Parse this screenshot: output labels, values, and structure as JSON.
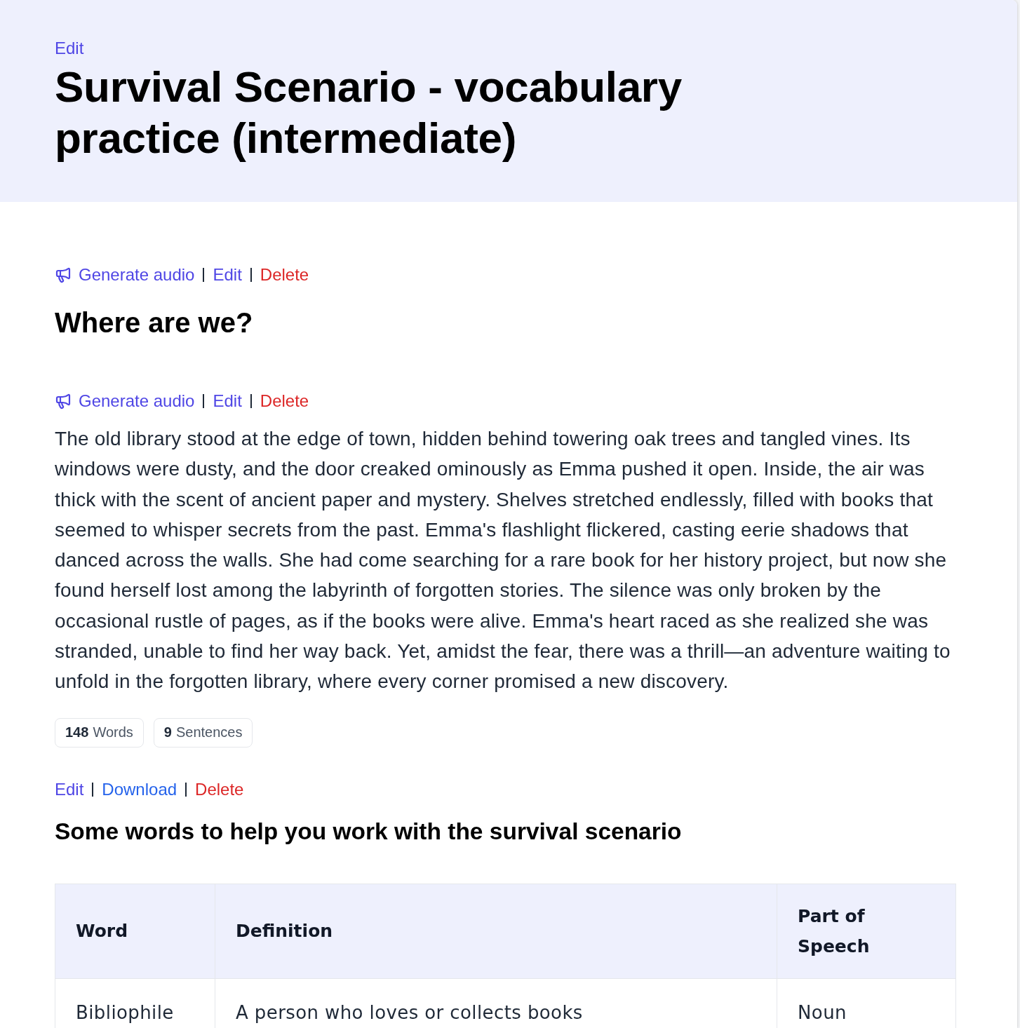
{
  "header": {
    "edit_link": "Edit",
    "title": "Survival Scenario - vocabulary practice (intermediate)"
  },
  "sections": [
    {
      "kind": "heading",
      "actions": [
        {
          "kind": "audio",
          "label": "Generate audio"
        },
        {
          "kind": "edit",
          "label": "Edit"
        },
        {
          "kind": "delete",
          "label": "Delete"
        }
      ],
      "heading": "Where are we?"
    },
    {
      "kind": "passage",
      "actions": [
        {
          "kind": "audio",
          "label": "Generate audio"
        },
        {
          "kind": "edit",
          "label": "Edit"
        },
        {
          "kind": "delete",
          "label": "Delete"
        }
      ],
      "text": "The old library stood at the edge of town, hidden behind towering oak trees and tangled vines. Its windows were dusty, and the door creaked ominously as Emma pushed it open. Inside, the air was thick with the scent of ancient paper and mystery. Shelves stretched endlessly, filled with books that seemed to whisper secrets from the past. Emma's flashlight flickered, casting eerie shadows that danced across the walls. She had come searching for a rare book for her history project, but now she found herself lost among the labyrinth of forgotten stories. The silence was only broken by the occasional rustle of pages, as if the books were alive. Emma's heart raced as she realized she was stranded, unable to find her way back. Yet, amidst the fear, there was a thrill—an adventure waiting to unfold in the forgotten library, where every corner promised a new discovery.",
      "stats": [
        {
          "value": "148",
          "label": "Words"
        },
        {
          "value": "9",
          "label": "Sentences"
        }
      ]
    },
    {
      "kind": "glossary",
      "actions": [
        {
          "kind": "edit",
          "label": "Edit"
        },
        {
          "kind": "download",
          "label": "Download"
        },
        {
          "kind": "delete",
          "label": "Delete"
        }
      ],
      "heading": "Some words to help you work with the survival scenario",
      "table": {
        "columns": [
          "Word",
          "Definition",
          "Part of Speech"
        ],
        "rows": [
          [
            "Bibliophile",
            "A person who loves or collects books",
            "Noun"
          ]
        ]
      }
    }
  ]
}
